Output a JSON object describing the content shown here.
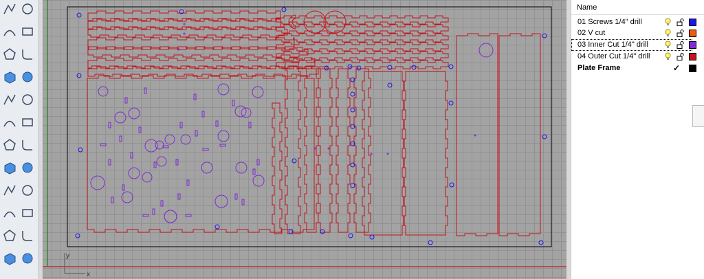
{
  "layers_panel": {
    "header": "Name",
    "layers": [
      {
        "name": "01 Screws 1/4\" drill",
        "color": "#1c17e6",
        "current": false,
        "selected": false
      },
      {
        "name": "02 V cut",
        "color": "#f05a0e",
        "current": false,
        "selected": false
      },
      {
        "name": "03 Inner Cut 1/4\" drill",
        "color": "#7f2bd1",
        "current": false,
        "selected": true
      },
      {
        "name": "04 Outer Cut 1/4\" drill",
        "color": "#c2161c",
        "current": false,
        "selected": false
      },
      {
        "name": "Plate Frame",
        "color": "#000000",
        "current": true,
        "selected": false,
        "check": "✓"
      }
    ]
  },
  "viewport": {
    "axis_labels": {
      "y": "y",
      "x": "x"
    },
    "colors": {
      "outer_cut": "#c2161c",
      "inner_cut": "#7f2bd1",
      "screws": "#1c17e6",
      "frame": "#000000",
      "x_axis": "#b83030",
      "y_axis": "#2e8a2e"
    }
  },
  "toolbar": {
    "icons": [
      "polyline-icon",
      "circle-icon",
      "arc-icon",
      "rectangle-icon",
      "polygon-icon",
      "curve-fillet-icon",
      "box-icon",
      "sphere-icon",
      "cylinder-icon",
      "plane-surface-icon",
      "explode-icon",
      "join-icon",
      "boolean-union-icon",
      "boolean-split-icon",
      "curve-from-object-icon",
      "offset-curve-icon",
      "extrude-icon",
      "move-icon",
      "array-icon",
      "align-icon",
      "box-edit-icon",
      "dimension-icon",
      "grid-snap-icon",
      "analyze-icon"
    ]
  }
}
